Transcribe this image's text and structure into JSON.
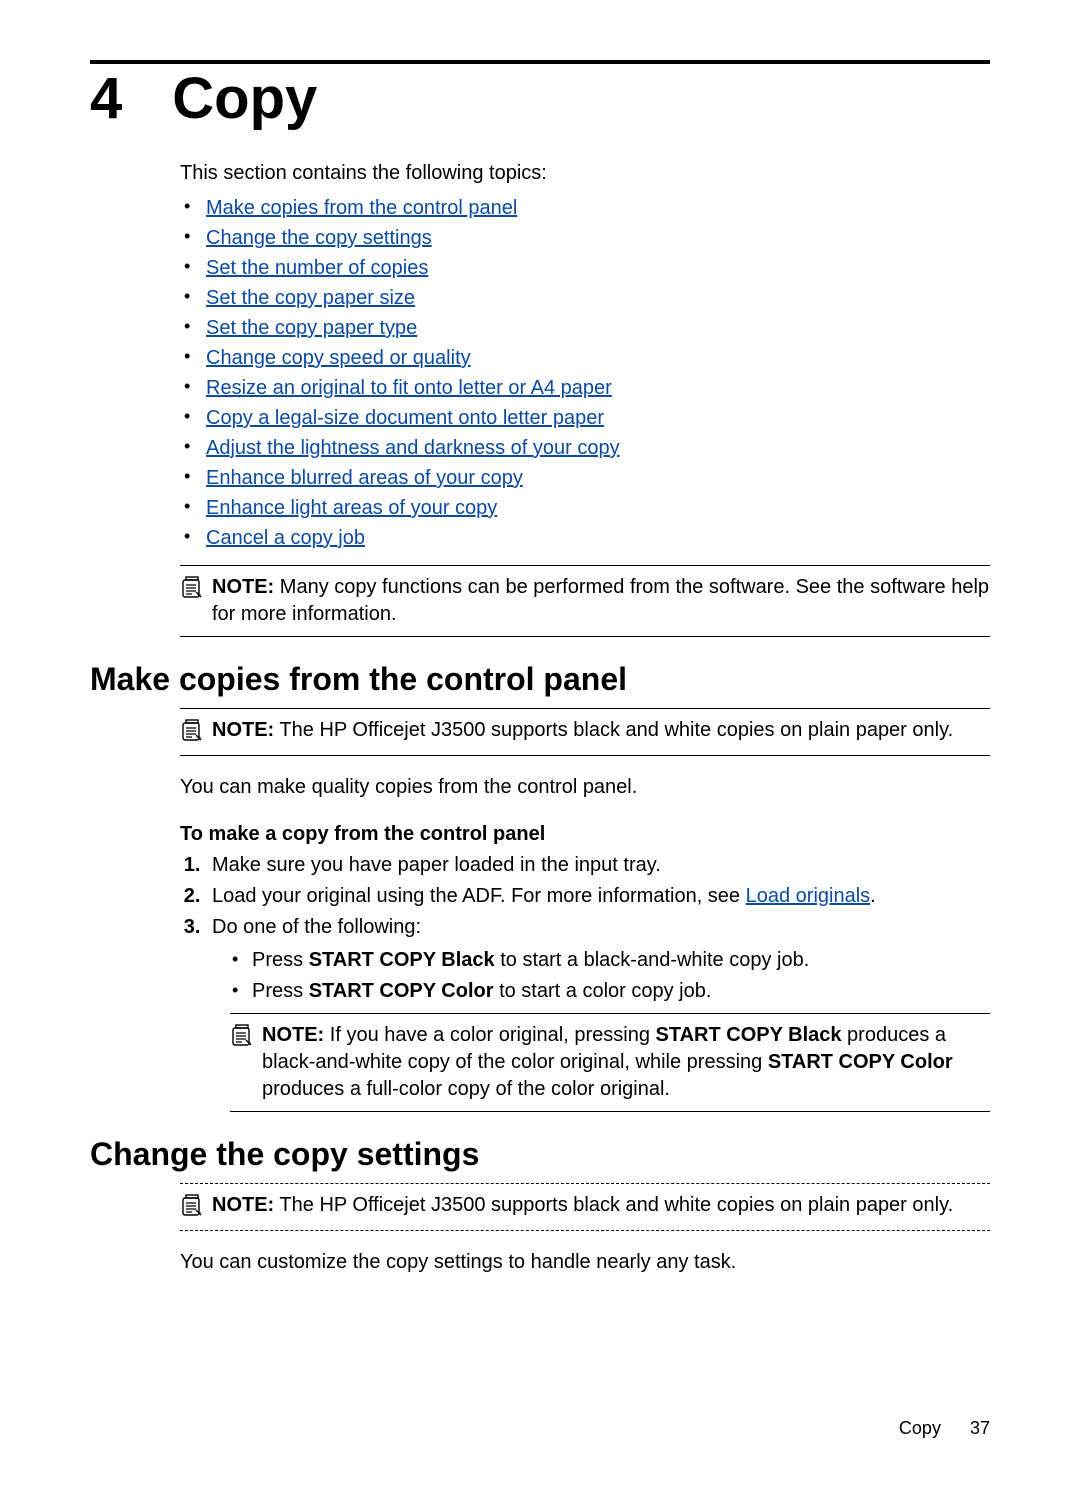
{
  "chapter": {
    "number": "4",
    "title": "Copy"
  },
  "intro": "This section contains the following topics:",
  "toc": [
    "Make copies from the control panel",
    "Change the copy settings",
    "Set the number of copies",
    "Set the copy paper size",
    "Set the copy paper type",
    "Change copy speed or quality",
    "Resize an original to fit onto letter or A4 paper",
    "Copy a legal-size document onto letter paper",
    "Adjust the lightness and darkness of your copy",
    "Enhance blurred areas of your copy",
    "Enhance light areas of your copy",
    "Cancel a copy job"
  ],
  "note_label": "NOTE:",
  "note_toc": "Many copy functions can be performed from the software. See the software help for more information.",
  "section1": {
    "title": "Make copies from the control panel",
    "note": "The HP Officejet J3500 supports black and white copies on plain paper only.",
    "para": "You can make quality copies from the control panel.",
    "subhead": "To make a copy from the control panel",
    "steps": {
      "s1": "Make sure you have paper loaded in the input tray.",
      "s2_a": "Load your original using the ADF. For more information, see ",
      "s2_link": "Load originals",
      "s2_b": ".",
      "s3": "Do one of the following:",
      "bullet1_a": "Press ",
      "bullet1_b": "START COPY Black",
      "bullet1_c": " to start a black-and-white copy job.",
      "bullet2_a": "Press ",
      "bullet2_b": "START COPY Color",
      "bullet2_c": " to start a color copy job.",
      "note_a": "If you have a color original, pressing ",
      "note_b": "START COPY Black",
      "note_c": " produces a black-and-white copy of the color original, while pressing ",
      "note_d": "START COPY Color",
      "note_e": " produces a full-color copy of the color original."
    }
  },
  "section2": {
    "title": "Change the copy settings",
    "note": "The HP Officejet J3500 supports black and white copies on plain paper only.",
    "para": "You can customize the copy settings to handle nearly any task."
  },
  "footer": {
    "section": "Copy",
    "page": "37"
  }
}
